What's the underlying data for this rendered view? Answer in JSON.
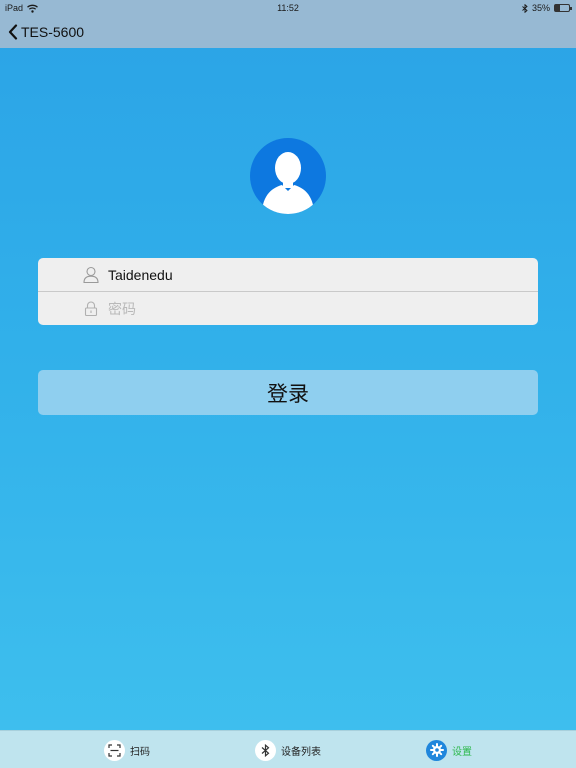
{
  "status_bar": {
    "device": "iPad",
    "time": "11:52",
    "battery_text": "35%",
    "battery_level": 0.35
  },
  "nav_bar": {
    "back_title": "TES-5600"
  },
  "login": {
    "username_value": "Taidenedu",
    "password_placeholder": "密码",
    "submit_label": "登录"
  },
  "tab_bar": {
    "items": [
      {
        "label": "扫码",
        "icon": "scan-icon",
        "active": false
      },
      {
        "label": "设备列表",
        "icon": "bluetooth-icon",
        "active": false
      },
      {
        "label": "设置",
        "icon": "gear-icon",
        "active": true
      }
    ]
  },
  "colors": {
    "nav_background": "#97b9d3",
    "avatar": "#0d78e0",
    "button": "#8fcfef",
    "active_tab_label": "#2db84c",
    "active_tab_icon": "#1f86dc"
  }
}
